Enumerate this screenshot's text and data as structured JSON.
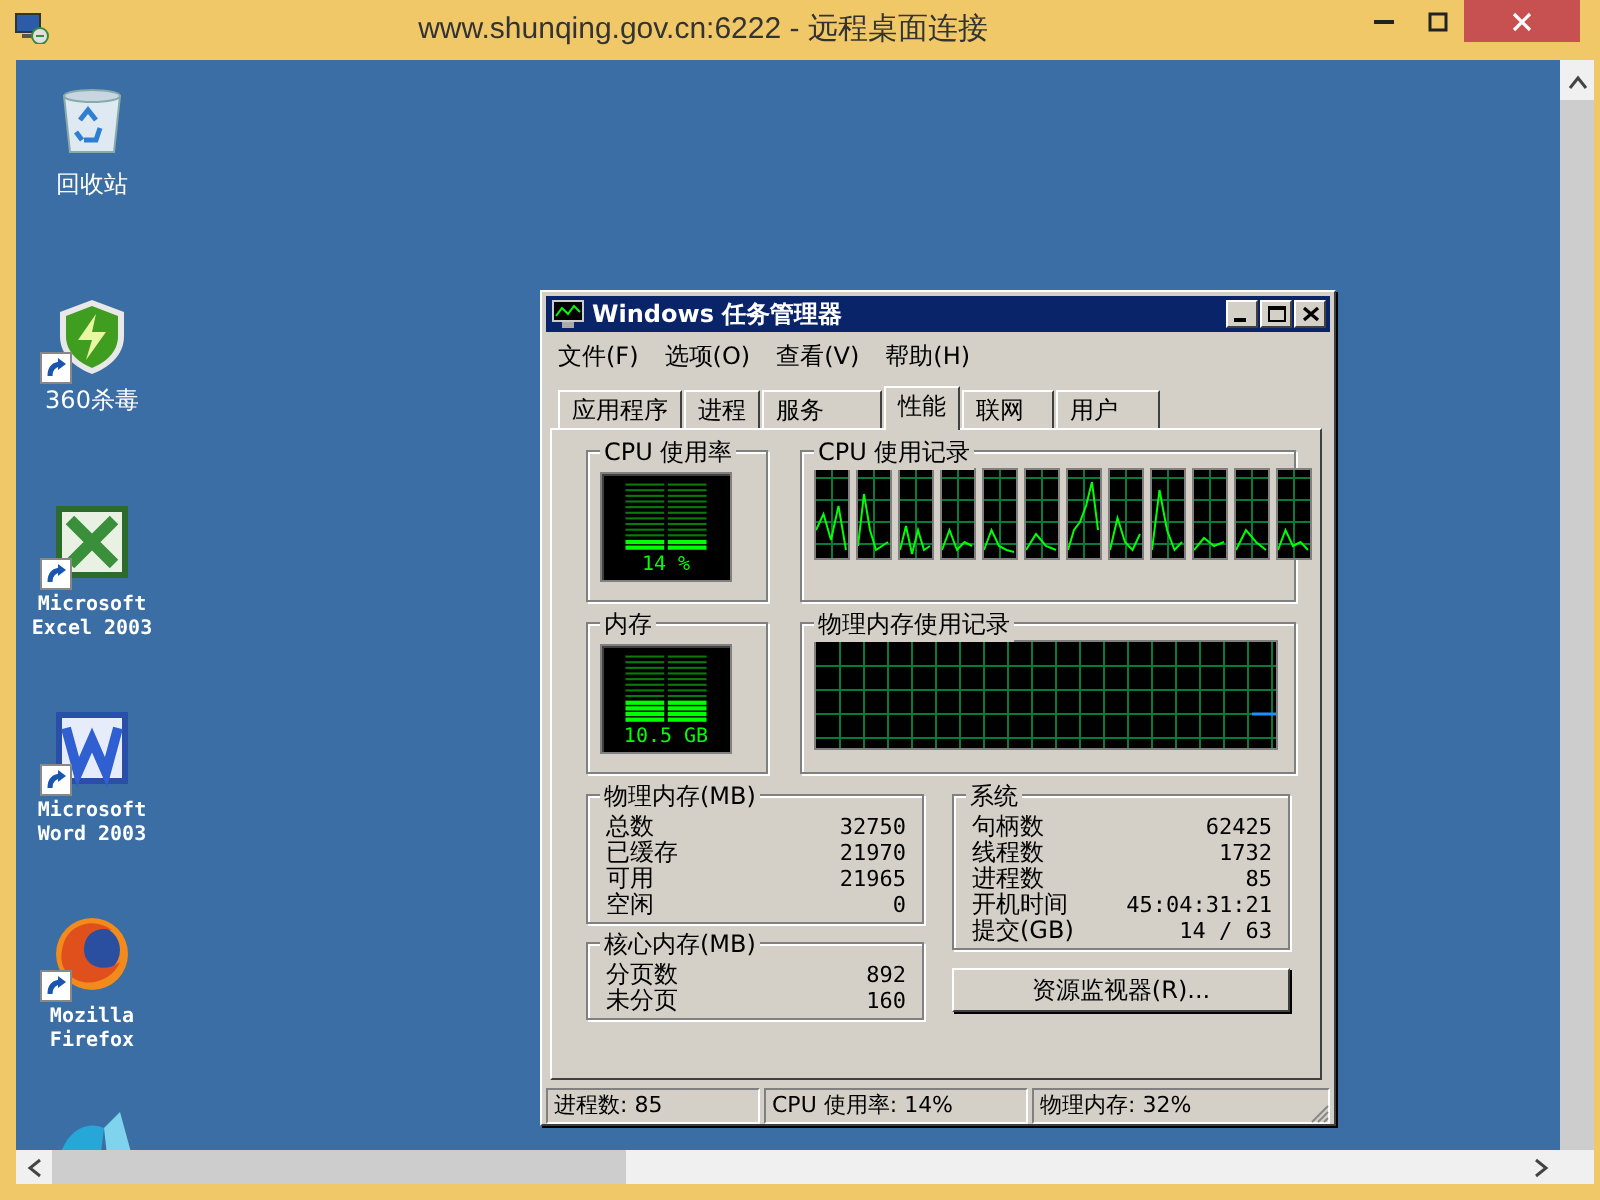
{
  "window": {
    "title": "www.shunqing.gov.cn:6222 - 远程桌面连接"
  },
  "desktop_icons": [
    {
      "kind": "recycle",
      "label": "回收站",
      "shortcut": false
    },
    {
      "kind": "shield",
      "label": "360杀毒",
      "shortcut": true
    },
    {
      "kind": "excel",
      "label": "Microsoft Excel 2003",
      "shortcut": true
    },
    {
      "kind": "word",
      "label": "Microsoft Word 2003",
      "shortcut": true
    },
    {
      "kind": "firefox",
      "label": "Mozilla Firefox",
      "shortcut": true
    },
    {
      "kind": "fan"
    }
  ],
  "task_manager": {
    "title": "Windows 任务管理器",
    "menu": [
      "文件(F)",
      "选项(O)",
      "查看(V)",
      "帮助(H)"
    ],
    "tabs": [
      {
        "label": "应用程序",
        "selected": false
      },
      {
        "label": "进程",
        "selected": false
      },
      {
        "label": "服务",
        "selected": false
      },
      {
        "label": "性能",
        "selected": true
      },
      {
        "label": "联网",
        "selected": false
      },
      {
        "label": "用户",
        "selected": false
      }
    ],
    "cpu_usage": {
      "title": "CPU 使用率",
      "reading": "14 %",
      "level": 0.14
    },
    "cpu_history": {
      "title": "CPU 使用记录"
    },
    "memory": {
      "title": "内存",
      "reading": "10.5 GB",
      "level": 0.32
    },
    "memory_history": {
      "title": "物理内存使用记录"
    },
    "physical_memory": {
      "title": "物理内存(MB)",
      "rows": [
        {
          "label": "总数",
          "value": "32750"
        },
        {
          "label": "已缓存",
          "value": "21970"
        },
        {
          "label": "可用",
          "value": "21965"
        },
        {
          "label": "空闲",
          "value": "0"
        }
      ]
    },
    "kernel_memory": {
      "title": "核心内存(MB)",
      "rows": [
        {
          "label": "分页数",
          "value": "892"
        },
        {
          "label": "未分页",
          "value": "160"
        }
      ]
    },
    "system": {
      "title": "系统",
      "rows": [
        {
          "label": "句柄数",
          "value": "62425"
        },
        {
          "label": "线程数",
          "value": "1732"
        },
        {
          "label": "进程数",
          "value": "85"
        },
        {
          "label": "开机时间",
          "value": "45:04:31:21"
        },
        {
          "label": "提交(GB)",
          "value": "14 / 63"
        }
      ]
    },
    "resource_monitor_button": "资源监视器(R)...",
    "status_bar": [
      "进程数: 85",
      "CPU 使用率: 14%",
      "物理内存: 32%"
    ]
  }
}
